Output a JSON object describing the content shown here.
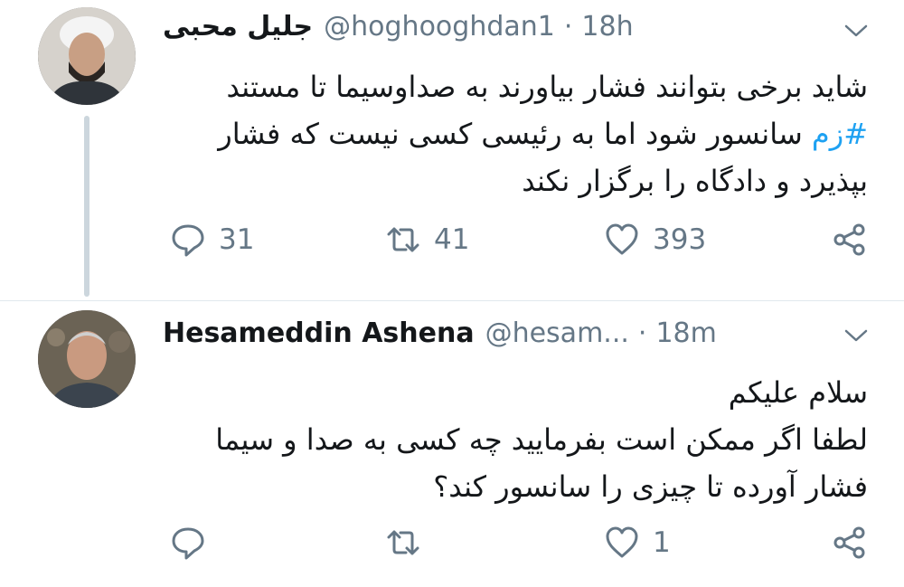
{
  "tweets": [
    {
      "author_name": "جلیل محبی",
      "handle": "@hoghooghdan1",
      "separator": "·",
      "time": "18h",
      "text_hashtag": "#زم",
      "text_lines": [
        "شاید برخی بتوانند فشار بیاورند به صداوسیما تا مستند",
        "سانسور شود اما به رئیسی کسی نیست که فشار",
        "بپذیرد و دادگاه را برگزار نکند"
      ],
      "reply_count": "31",
      "retweet_count": "41",
      "like_count": "393",
      "icons": [
        "reply-icon",
        "retweet-icon",
        "like-icon",
        "share-icon",
        "chevron-down-icon"
      ]
    },
    {
      "author_name": "Hesameddin Ashena",
      "handle": "@hesam...",
      "separator": "·",
      "time": "18m",
      "text_lines": [
        "سلام علیکم",
        "لطفا اگر ممکن است بفرمایید چه کسی به صدا و سیما",
        "فشار آورده تا چیزی را سانسور کند؟"
      ],
      "reply_count": "",
      "retweet_count": "",
      "like_count": "1",
      "icons": [
        "reply-icon",
        "retweet-icon",
        "like-icon",
        "share-icon",
        "chevron-down-icon"
      ]
    }
  ],
  "colors": {
    "text": "#14171a",
    "secondary": "#657786",
    "link": "#1da1f2",
    "thread_line": "#ccd6dd",
    "divider": "#e1e8ed"
  }
}
